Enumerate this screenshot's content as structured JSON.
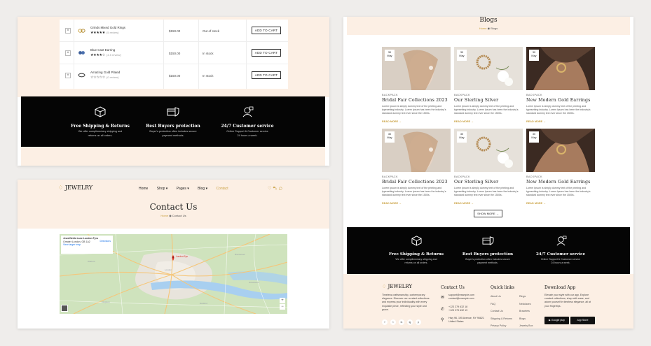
{
  "wishlist": {
    "rows": [
      {
        "name": "Grinds Mixed Gold Rings",
        "stars": "★★★★★",
        "reviews": "(5 review)",
        "price": "$150.00",
        "stock": "Out of stock",
        "button": "ADD TO CART"
      },
      {
        "name": "Blue Cast Earring",
        "stars": "★★★★☆",
        "reviews": "(4.5 review)",
        "price": "$150.00",
        "stock": "In stock",
        "button": "ADD TO CART"
      },
      {
        "name": "Amazing Gold Plated",
        "stars": "☆☆☆☆☆",
        "reviews": "(0 review)",
        "price": "$150.00",
        "stock": "In stock",
        "button": "ADD TO CART"
      }
    ]
  },
  "features": [
    {
      "title": "Free Shipping & Returns",
      "desc1": "We offer complimentary shipping and",
      "desc2": "returns on all orders.",
      "icon": "box-icon"
    },
    {
      "title": "Best Buyers protection",
      "desc1": "Buyer's protection often includes secure",
      "desc2": "payment methods.",
      "icon": "shield-card-icon"
    },
    {
      "title": "24/7 Customer service",
      "desc1": "Online Support & Customer service",
      "desc2": "24 hours a week.",
      "icon": "customer-service-icon"
    }
  ],
  "contact_page": {
    "logo": "JEWELRY",
    "menu": [
      "Home",
      "Shop ▾",
      "Pages ▾",
      "Blog ▾",
      "Contact"
    ],
    "title": "Contact Us",
    "breadcrumb_home": "Home",
    "breadcrumb_current": "Contact Us",
    "map_info_title": "Jewelfields Lane London Fyro",
    "map_info_line": "Greater London, GB 1A2",
    "map_info_link": "View larger map",
    "map_directions": "Directions",
    "map_marker_label": "London Eye",
    "zoom_in": "+",
    "zoom_out": "−"
  },
  "blog_page": {
    "title": "Blogs",
    "breadcrumb_home": "Home",
    "breadcrumb_current": "Blogs",
    "posts": [
      {
        "day": "30",
        "month": "May",
        "category": "BACKPACK",
        "title": "Bridal Fair Collections 2023",
        "excerpt": "Lorem Ipsum is simply dummy text of the printing and typesetting industry. Lorem Ipsum has been the industry's standard dummy text ever since the 1500s.",
        "more": "READ MORE →"
      },
      {
        "day": "30",
        "month": "May",
        "category": "BACKPACK",
        "title": "Our Sterling Silver",
        "excerpt": "Lorem Ipsum is simply dummy text of the printing and typesetting industry. Lorem Ipsum has been the industry's standard dummy text ever since the 1500s.",
        "more": "READ MORE →"
      },
      {
        "day": "30",
        "month": "May",
        "category": "BACKPACK",
        "title": "New Modern Gold Earrings",
        "excerpt": "Lorem Ipsum is simply dummy text of the printing and typesetting industry. Lorem Ipsum has been the industry's standard dummy text ever since the 1500s.",
        "more": "READ MORE →"
      },
      {
        "day": "30",
        "month": "May",
        "category": "BACKPACK",
        "title": "Bridal Fair Collections 2023",
        "excerpt": "Lorem Ipsum is simply dummy text of the printing and typesetting industry. Lorem Ipsum has been the industry's standard dummy text ever since the 1500s.",
        "more": "READ MORE →"
      },
      {
        "day": "30",
        "month": "May",
        "category": "BACKPACK",
        "title": "Our Sterling Silver",
        "excerpt": "Lorem Ipsum is simply dummy text of the printing and typesetting industry. Lorem Ipsum has been the industry's standard dummy text ever since the 1500s.",
        "more": "READ MORE →"
      },
      {
        "day": "30",
        "month": "May",
        "category": "BACKPACK",
        "title": "New Modern Gold Earrings",
        "excerpt": "Lorem Ipsum is simply dummy text of the printing and typesetting industry. Lorem Ipsum has been the industry's standard dummy text ever since the 1500s.",
        "more": "READ MORE →"
      }
    ],
    "show_more": "SHOW MORE →",
    "footer": {
      "logo": "JEWELRY",
      "about": "Timeless craftsmanship, contemporary elegance. Discover our curated collections and express your individuality with every exquisite piece, reflecting your style and grace.",
      "contact_head": "Contact Us",
      "email1": "support@example.com",
      "email2": "contact@example.com",
      "phone1": "+123 279 632 18",
      "phone2": "+123 279 632 19",
      "address1": "Hwy 96, 195 Avenue, NY 96821",
      "address2": "United States",
      "quick_head": "Quick links",
      "quick_col1": [
        "About Us",
        "FAQ",
        "Contact Us",
        "Shipping & Returns",
        "Privacy Policy"
      ],
      "quick_col2": [
        "Rings",
        "Necklaces",
        "Bracelets",
        "Blogs",
        "Jewelry Box"
      ],
      "app_head": "Download App",
      "app_text": "Elevate your style with our app. Explore curated collections, shop with ease, and adorn yourself in timeless elegance, all at your fingertips.",
      "google_play": "Google play",
      "app_store": "App Store",
      "social": [
        "f",
        "t",
        "in",
        "ig",
        "p"
      ]
    }
  },
  "colors": {
    "accent": "#c9a040",
    "dark": "#050505",
    "beige": "#fcefe4"
  }
}
